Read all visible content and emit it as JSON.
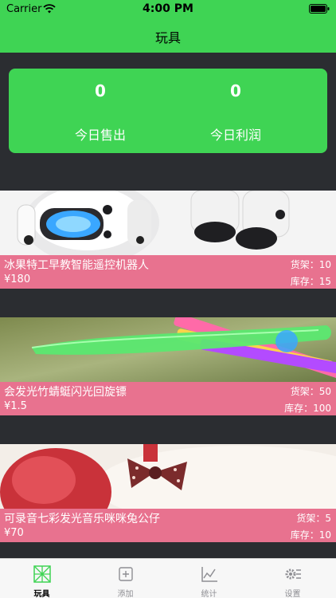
{
  "status": {
    "carrier": "Carrier",
    "time": "4:00 PM"
  },
  "nav": {
    "title": "玩具"
  },
  "summary": {
    "sold_today": "0",
    "sold_today_label": "今日售出",
    "profit_today": "0",
    "profit_today_label": "今日利润"
  },
  "products": [
    {
      "name": "冰果特工早教智能遥控机器人",
      "price": "¥180",
      "shelf": "货架：10",
      "stock": "库存：15"
    },
    {
      "name": "会发光竹蜻蜓闪光回旋镖",
      "price": "¥1.5",
      "shelf": "货架：50",
      "stock": "库存：100"
    },
    {
      "name": "可录音七彩发光音乐咪咪兔公仔",
      "price": "¥70",
      "shelf": "货架：5",
      "stock": "库存：10"
    }
  ],
  "tabs": [
    {
      "label": "玩具",
      "icon": "pinwheel-icon",
      "active": true
    },
    {
      "label": "添加",
      "icon": "add-icon",
      "active": false
    },
    {
      "label": "统计",
      "icon": "chart-icon",
      "active": false
    },
    {
      "label": "设置",
      "icon": "settings-icon",
      "active": false
    }
  ],
  "colors": {
    "accent": "#3fd454",
    "card_info": "#e8728f",
    "background": "#2b2d31"
  }
}
